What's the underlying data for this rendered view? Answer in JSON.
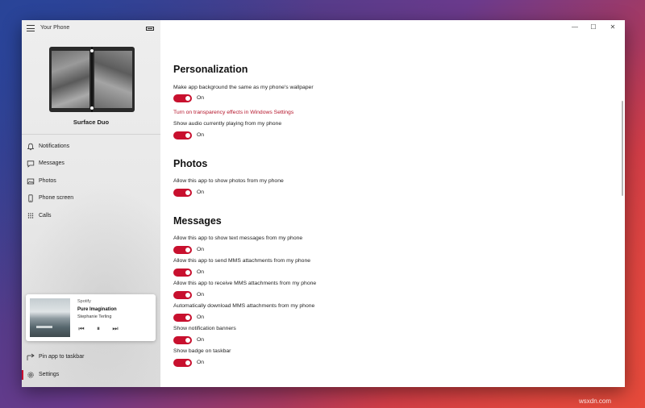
{
  "app": {
    "title": "Your Phone"
  },
  "device": {
    "name": "Surface Duo"
  },
  "nav": {
    "notifications": "Notifications",
    "messages": "Messages",
    "photos": "Photos",
    "phone_screen": "Phone screen",
    "calls": "Calls"
  },
  "media": {
    "source": "Spotify",
    "song": "Pure Imagination",
    "artist": "Stephanie Terling"
  },
  "sidebar_bottom": {
    "pin": "Pin app to taskbar",
    "settings": "Settings"
  },
  "window_controls": {
    "minimize": "—",
    "maximize": "☐",
    "close": "✕"
  },
  "sections": {
    "personalization": {
      "title": "Personalization",
      "wallpaper_label": "Make app background the same as my phone's wallpaper",
      "wallpaper_state": "On",
      "transparency_link": "Turn on transparency effects in Windows Settings",
      "audio_label": "Show audio currently playing from my phone",
      "audio_state": "On"
    },
    "photos": {
      "title": "Photos",
      "allow_label": "Allow this app to show photos from my phone",
      "allow_state": "On"
    },
    "messages": {
      "title": "Messages",
      "settings": [
        {
          "label": "Allow this app to show text messages from my phone",
          "state": "On"
        },
        {
          "label": "Allow this app to send MMS attachments from my phone",
          "state": "On"
        },
        {
          "label": "Allow this app to receive MMS attachments from my phone",
          "state": "On"
        },
        {
          "label": "Automatically download MMS attachments from my phone",
          "state": "On"
        },
        {
          "label": "Show notification banners",
          "state": "On"
        },
        {
          "label": "Show badge on taskbar",
          "state": "On"
        }
      ]
    }
  },
  "watermark": "wsxdn.com",
  "colors": {
    "accent": "#c8102e",
    "link": "#b5152b"
  }
}
